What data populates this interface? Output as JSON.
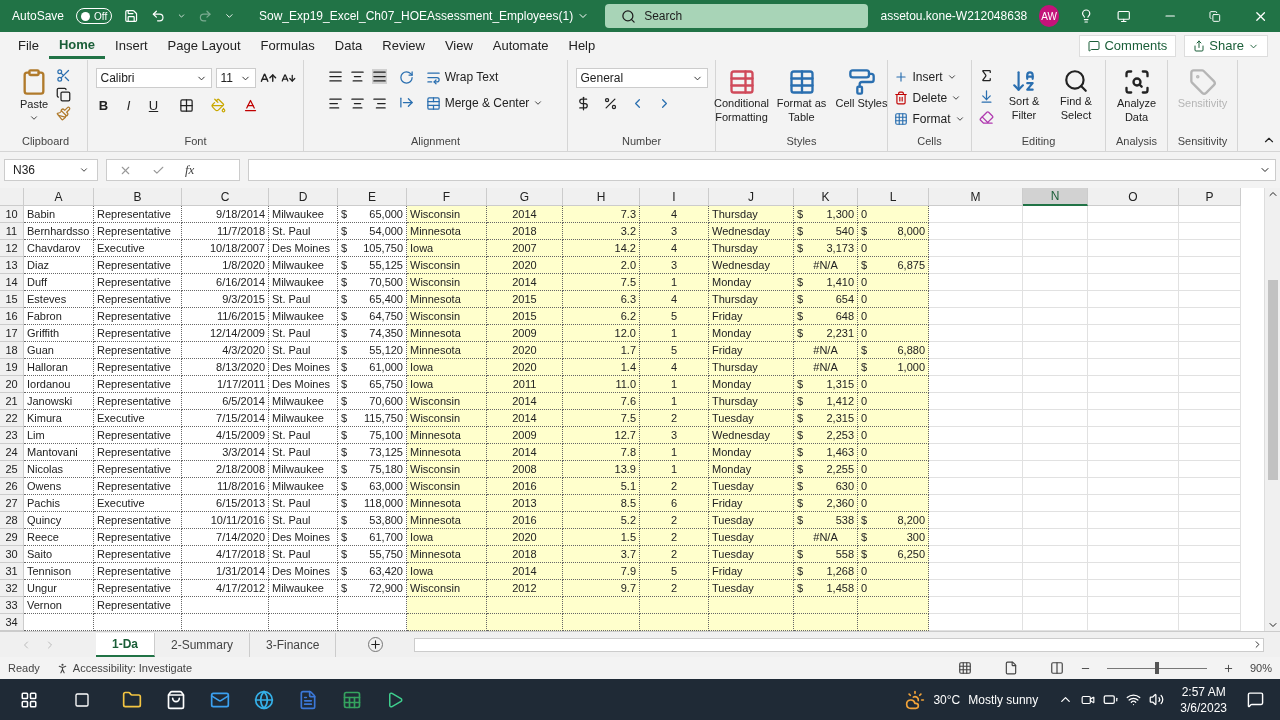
{
  "title_bar": {
    "autosave_label": "AutoSave",
    "autosave": {
      "on": false,
      "label": "Off"
    },
    "filename": "Sow_Exp19_Excel_Ch07_HOEAssessment_Employees(1)",
    "search_placeholder": "Search",
    "user": "assetou.kone-W212048638",
    "avatar": "AW"
  },
  "menu": [
    {
      "label": "File",
      "selected": false
    },
    {
      "label": "Home",
      "selected": true
    },
    {
      "label": "Insert",
      "selected": false
    },
    {
      "label": "Page Layout",
      "selected": false
    },
    {
      "label": "Formulas",
      "selected": false
    },
    {
      "label": "Data",
      "selected": false
    },
    {
      "label": "Review",
      "selected": false
    },
    {
      "label": "View",
      "selected": false
    },
    {
      "label": "Automate",
      "selected": false
    },
    {
      "label": "Help",
      "selected": false
    }
  ],
  "actions": {
    "comments": "Comments",
    "share": "Share"
  },
  "ribbon": {
    "clipboard": {
      "label": "Clipboard",
      "paste": "Paste"
    },
    "font": {
      "label": "Font",
      "name": "Calibri",
      "size": "11",
      "styles": [
        "B",
        "I",
        "U"
      ]
    },
    "alignment": {
      "label": "Alignment",
      "wrap": "Wrap Text",
      "merge": "Merge & Center"
    },
    "number": {
      "label": "Number",
      "format": "General"
    },
    "styles": {
      "label": "Styles",
      "buttons": [
        "Conditional Formatting",
        "Format as Table",
        "Cell Styles"
      ]
    },
    "cells": {
      "label": "Cells",
      "buttons": [
        "Insert",
        "Delete",
        "Format"
      ]
    },
    "editing": {
      "label": "Editing",
      "buttons": [
        "Sort & Filter",
        "Find & Select"
      ]
    },
    "analysis": {
      "label": "Analysis",
      "button": "Analyze Data"
    },
    "sensitivity": {
      "label": "Sensitivity",
      "button": "Sensitivity",
      "disabled": true
    }
  },
  "formula_bar": {
    "name_box": "N36",
    "fx": "fx"
  },
  "columns": [
    {
      "label": "A",
      "selected": false
    },
    {
      "label": "B",
      "selected": false
    },
    {
      "label": "C",
      "selected": false
    },
    {
      "label": "D",
      "selected": false
    },
    {
      "label": "E",
      "selected": false
    },
    {
      "label": "F",
      "selected": false
    },
    {
      "label": "G",
      "selected": false
    },
    {
      "label": "H",
      "selected": false
    },
    {
      "label": "I",
      "selected": false
    },
    {
      "label": "J",
      "selected": false
    },
    {
      "label": "K",
      "selected": false
    },
    {
      "label": "L",
      "selected": false
    },
    {
      "label": "M",
      "selected": false
    },
    {
      "label": "N",
      "selected": true
    },
    {
      "label": "O",
      "selected": false
    },
    {
      "label": "P",
      "selected": false
    }
  ],
  "rows": [
    {
      "num": "10",
      "cells": [
        "Babin",
        "Representative",
        "9/18/2014",
        "Milwaukee",
        [
          "$",
          "65,000"
        ],
        "Wisconsin",
        "2014",
        "7.3",
        "4",
        "Thursday",
        [
          "$",
          "1,300"
        ],
        "0"
      ]
    },
    {
      "num": "11",
      "cells": [
        "Bernhardsso",
        "Representative",
        "11/7/2018",
        "St. Paul",
        [
          "$",
          "54,000"
        ],
        "Minnesota",
        "2018",
        "3.2",
        "3",
        "Wednesday",
        [
          "$",
          "540"
        ],
        [
          "$",
          "8,000"
        ]
      ]
    },
    {
      "num": "12",
      "cells": [
        "Chavdarov",
        "Executive",
        "10/18/2007",
        "Des Moines",
        [
          "$",
          "105,750"
        ],
        "Iowa",
        "2007",
        "14.2",
        "4",
        "Thursday",
        [
          "$",
          "3,173"
        ],
        "0"
      ]
    },
    {
      "num": "13",
      "cells": [
        "Diaz",
        "Representative",
        "1/8/2020",
        "Milwaukee",
        [
          "$",
          "55,125"
        ],
        "Wisconsin",
        "2020",
        "2.0",
        "3",
        "Wednesday",
        "#N/A",
        [
          "$",
          "6,875"
        ]
      ]
    },
    {
      "num": "14",
      "cells": [
        "Duff",
        "Representative",
        "6/16/2014",
        "Milwaukee",
        [
          "$",
          "70,500"
        ],
        "Wisconsin",
        "2014",
        "7.5",
        "1",
        "Monday",
        [
          "$",
          "1,410"
        ],
        "0"
      ]
    },
    {
      "num": "15",
      "cells": [
        "Esteves",
        "Representative",
        "9/3/2015",
        "St. Paul",
        [
          "$",
          "65,400"
        ],
        "Minnesota",
        "2015",
        "6.3",
        "4",
        "Thursday",
        [
          "$",
          "654"
        ],
        "0"
      ]
    },
    {
      "num": "16",
      "cells": [
        "Fabron",
        "Representative",
        "11/6/2015",
        "Milwaukee",
        [
          "$",
          "64,750"
        ],
        "Wisconsin",
        "2015",
        "6.2",
        "5",
        "Friday",
        [
          "$",
          "648"
        ],
        "0"
      ]
    },
    {
      "num": "17",
      "cells": [
        "Griffith",
        "Representative",
        "12/14/2009",
        "St. Paul",
        [
          "$",
          "74,350"
        ],
        "Minnesota",
        "2009",
        "12.0",
        "1",
        "Monday",
        [
          "$",
          "2,231"
        ],
        "0"
      ]
    },
    {
      "num": "18",
      "cells": [
        "Guan",
        "Representative",
        "4/3/2020",
        "St. Paul",
        [
          "$",
          "55,120"
        ],
        "Minnesota",
        "2020",
        "1.7",
        "5",
        "Friday",
        "#N/A",
        [
          "$",
          "6,880"
        ]
      ]
    },
    {
      "num": "19",
      "cells": [
        "Halloran",
        "Representative",
        "8/13/2020",
        "Des Moines",
        [
          "$",
          "61,000"
        ],
        "Iowa",
        "2020",
        "1.4",
        "4",
        "Thursday",
        "#N/A",
        [
          "$",
          "1,000"
        ]
      ]
    },
    {
      "num": "20",
      "cells": [
        "Iordanou",
        "Representative",
        "1/17/2011",
        "Des Moines",
        [
          "$",
          "65,750"
        ],
        "Iowa",
        "2011",
        "11.0",
        "1",
        "Monday",
        [
          "$",
          "1,315"
        ],
        "0"
      ]
    },
    {
      "num": "21",
      "cells": [
        "Janowski",
        "Representative",
        "6/5/2014",
        "Milwaukee",
        [
          "$",
          "70,600"
        ],
        "Wisconsin",
        "2014",
        "7.6",
        "1",
        "Thursday",
        [
          "$",
          "1,412"
        ],
        "0"
      ]
    },
    {
      "num": "22",
      "cells": [
        "Kimura",
        "Executive",
        "7/15/2014",
        "Milwaukee",
        [
          "$",
          "115,750"
        ],
        "Wisconsin",
        "2014",
        "7.5",
        "2",
        "Tuesday",
        [
          "$",
          "2,315"
        ],
        "0"
      ]
    },
    {
      "num": "23",
      "cells": [
        "Lim",
        "Representative",
        "4/15/2009",
        "St. Paul",
        [
          "$",
          "75,100"
        ],
        "Minnesota",
        "2009",
        "12.7",
        "3",
        "Wednesday",
        [
          "$",
          "2,253"
        ],
        "0"
      ]
    },
    {
      "num": "24",
      "cells": [
        "Mantovani",
        "Representative",
        "3/3/2014",
        "St. Paul",
        [
          "$",
          "73,125"
        ],
        "Minnesota",
        "2014",
        "7.8",
        "1",
        "Monday",
        [
          "$",
          "1,463"
        ],
        "0"
      ]
    },
    {
      "num": "25",
      "cells": [
        "Nicolas",
        "Representative",
        "2/18/2008",
        "Milwaukee",
        [
          "$",
          "75,180"
        ],
        "Wisconsin",
        "2008",
        "13.9",
        "1",
        "Monday",
        [
          "$",
          "2,255"
        ],
        "0"
      ]
    },
    {
      "num": "26",
      "cells": [
        "Owens",
        "Representative",
        "11/8/2016",
        "Milwaukee",
        [
          "$",
          "63,000"
        ],
        "Wisconsin",
        "2016",
        "5.1",
        "2",
        "Tuesday",
        [
          "$",
          "630"
        ],
        "0"
      ]
    },
    {
      "num": "27",
      "cells": [
        "Pachis",
        "Executive",
        "6/15/2013",
        "St. Paul",
        [
          "$",
          "118,000"
        ],
        "Minnesota",
        "2013",
        "8.5",
        "6",
        "Friday",
        [
          "$",
          "2,360"
        ],
        "0"
      ]
    },
    {
      "num": "28",
      "cells": [
        "Quincy",
        "Representative",
        "10/11/2016",
        "St. Paul",
        [
          "$",
          "53,800"
        ],
        "Minnesota",
        "2016",
        "5.2",
        "2",
        "Tuesday",
        [
          "$",
          "538"
        ],
        [
          "$",
          "8,200"
        ]
      ]
    },
    {
      "num": "29",
      "cells": [
        "Reece",
        "Representative",
        "7/14/2020",
        "Des Moines",
        [
          "$",
          "61,700"
        ],
        "Iowa",
        "2020",
        "1.5",
        "2",
        "Tuesday",
        "#N/A",
        [
          "$",
          "300"
        ]
      ]
    },
    {
      "num": "30",
      "cells": [
        "Saito",
        "Representative",
        "4/17/2018",
        "St. Paul",
        [
          "$",
          "55,750"
        ],
        "Minnesota",
        "2018",
        "3.7",
        "2",
        "Tuesday",
        [
          "$",
          "558"
        ],
        [
          "$",
          "6,250"
        ]
      ]
    },
    {
      "num": "31",
      "cells": [
        "Tennison",
        "Representative",
        "1/31/2014",
        "Des Moines",
        [
          "$",
          "63,420"
        ],
        "Iowa",
        "2014",
        "7.9",
        "5",
        "Friday",
        [
          "$",
          "1,268"
        ],
        "0"
      ]
    },
    {
      "num": "32",
      "cells": [
        "Ungur",
        "Representative",
        "4/17/2012",
        "Milwaukee",
        [
          "$",
          "72,900"
        ],
        "Wisconsin",
        "2012",
        "9.7",
        "2",
        "Tuesday",
        [
          "$",
          "1,458"
        ],
        "0"
      ]
    },
    {
      "num": "33",
      "cells": [
        "Vernon",
        "Representative"
      ]
    },
    {
      "num": "34",
      "cells": []
    }
  ],
  "sheets": [
    {
      "label": "1-Da",
      "selected": true
    },
    {
      "label": "2-Summary",
      "selected": false
    },
    {
      "label": "3-Finance",
      "selected": false
    }
  ],
  "status_bar": {
    "ready": "Ready",
    "accessibility": "Accessibility: Investigate",
    "zoom": "90%",
    "zoom_slider": {
      "level": 0.5
    }
  },
  "taskbar": {
    "weather": {
      "temp": "30°C",
      "text": "Mostly sunny"
    },
    "time": "2:57 AM",
    "date": "3/6/2023"
  }
}
